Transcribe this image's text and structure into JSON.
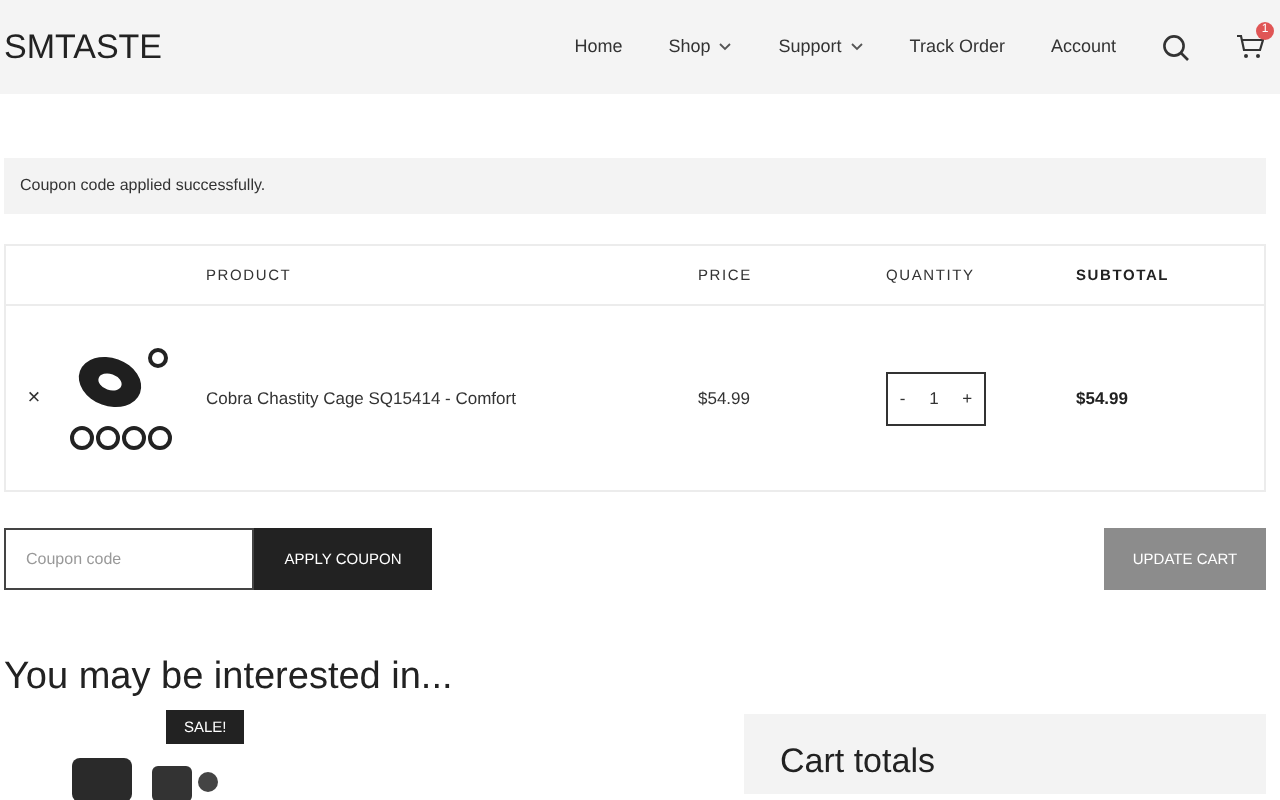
{
  "header": {
    "logo": "SMTASTE",
    "nav": [
      {
        "label": "Home",
        "dropdown": false
      },
      {
        "label": "Shop",
        "dropdown": true
      },
      {
        "label": "Support",
        "dropdown": true
      },
      {
        "label": "Track Order",
        "dropdown": false
      },
      {
        "label": "Account",
        "dropdown": false
      }
    ],
    "cart_count": "1"
  },
  "notice": "Coupon code applied successfully.",
  "table": {
    "columns": [
      "PRODUCT",
      "PRICE",
      "QUANTITY",
      "SUBTOTAL"
    ],
    "rows": [
      {
        "remove": "×",
        "product": "Cobra Chastity Cage SQ15414 - Comfort",
        "price": "$54.99",
        "quantity": {
          "minus": "-",
          "value": "1",
          "plus": "+"
        },
        "subtotal": "$54.99"
      }
    ]
  },
  "coupon": {
    "placeholder": "Coupon code",
    "apply": "APPLY COUPON",
    "update": "UPDATE CART"
  },
  "related": {
    "title": "You may be interested in...",
    "badge": "SALE!"
  },
  "totals": {
    "title": "Cart totals"
  }
}
